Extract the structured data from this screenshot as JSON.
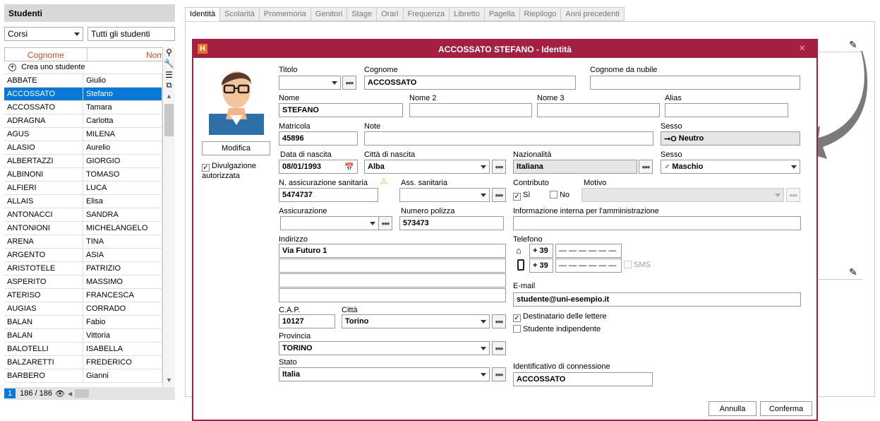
{
  "left": {
    "header": "Studenti",
    "combo_corsi": "Corsi",
    "combo_all": "Tutti gli studenti",
    "col_cognome": "Cognome",
    "col_nome": "Nome",
    "create_label": "Crea uno studente",
    "rows": [
      [
        "ABBATE",
        "Giulio"
      ],
      [
        "ACCOSSATO",
        "Stefano"
      ],
      [
        "ACCOSSATO",
        "Tamara"
      ],
      [
        "ADRAGNA",
        "Carlotta"
      ],
      [
        "AGUS",
        "MILENA"
      ],
      [
        "ALASIO",
        "Aurelio"
      ],
      [
        "ALBERTAZZI",
        "GIORGIO"
      ],
      [
        "ALBINONI",
        "TOMASO"
      ],
      [
        "ALFIERI",
        "LUCA"
      ],
      [
        "ALLAIS",
        "Elisa"
      ],
      [
        "ANTONACCI",
        "SANDRA"
      ],
      [
        "ANTONIONI",
        "MICHELANGELO"
      ],
      [
        "ARENA",
        "TINA"
      ],
      [
        "ARGENTO",
        "ASIA"
      ],
      [
        "ARISTOTELE",
        "PATRIZIO"
      ],
      [
        "ASPERITO",
        "MASSIMO"
      ],
      [
        "ATERISO",
        "FRANCESCA"
      ],
      [
        "AUGIAS",
        "CORRADO"
      ],
      [
        "BALAN",
        "Fabio"
      ],
      [
        "BALAN",
        "Vittoria"
      ],
      [
        "BALOTELLI",
        "ISABELLA"
      ],
      [
        "BALZARETTI",
        "FREDERICO"
      ],
      [
        "BARBERO",
        "Gianni"
      ]
    ],
    "page": "1",
    "count": "186 / 186"
  },
  "tabs": [
    "Identità",
    "Scolarità",
    "Promemoria",
    "Genitori",
    "Stage",
    "Orari",
    "Frequenza",
    "Libretto",
    "Pagella",
    "Riepilogo",
    "Anni precedenti"
  ],
  "dialog": {
    "title": "ACCOSSATO STEFANO - Identità",
    "logo": "H",
    "close": "×",
    "modifica": "Modifica",
    "divulgazione": "Divulgazione autorizzata",
    "labels": {
      "titolo": "Titolo",
      "cognome": "Cognome",
      "cognome_nubile": "Cognome da nubile",
      "nome": "Nome",
      "nome2": "Nome 2",
      "nome3": "Nome 3",
      "alias": "Alias",
      "matricola": "Matricola",
      "note": "Note",
      "sesso": "Sesso",
      "data_nascita": "Data di nascita",
      "citta_nascita": "Città di nascita",
      "nazionalita": "Nazionalità",
      "sesso2": "Sesso",
      "n_ass": "N. assicurazione sanitaria",
      "ass_sanitaria": "Ass. sanitaria",
      "contributo": "Contributo",
      "motivo": "Motivo",
      "assicurazione": "Assicurazione",
      "numero_polizza": "Numero polizza",
      "info_interna": "Informazione interna per l'amministrazione",
      "indirizzo": "Indirizzo",
      "telefono": "Telefono",
      "email": "E-mail",
      "cap": "C.A.P.",
      "citta": "Città",
      "provincia": "Provincia",
      "stato": "Stato",
      "identificativo": "Identificativo di connessione"
    },
    "values": {
      "cognome": "ACCOSSATO",
      "nome": "STEFANO",
      "matricola": "45896",
      "sesso_neutro": "Neutro",
      "data_nascita": "08/01/1993",
      "citta_nascita": "Alba",
      "nazionalita": "Italiana",
      "sesso": "Maschio",
      "n_ass": "5474737",
      "numero_polizza": "573473",
      "indirizzo1": "Via Futuro 1",
      "prefix1": "+ 39",
      "prefix2": "+ 39",
      "phone_blank1": "— — — — — —",
      "phone_blank2": "— — — — — —",
      "sms": "SMS",
      "email": "studente@uni-esempio.it",
      "cap": "10127",
      "citta": "Torino",
      "provincia": "TORINO",
      "stato": "Italia",
      "identificativo": "ACCOSSATO",
      "si": "Sì",
      "no": "No",
      "dest_lettere": "Destinatario delle lettere",
      "stud_indip": "Studente indipendente"
    },
    "annulla": "Annulla",
    "conferma": "Conferma"
  },
  "colors": {
    "accent": "#a32040",
    "selection": "#0a78d7",
    "header_text": "#c0502a"
  }
}
